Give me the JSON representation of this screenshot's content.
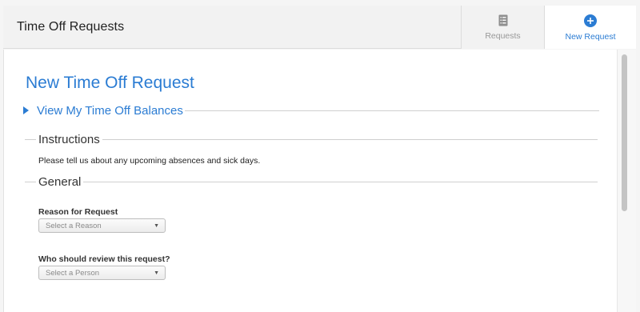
{
  "header": {
    "title": "Time Off Requests",
    "tabs": [
      {
        "label": "Requests",
        "icon": "list-document-icon"
      },
      {
        "label": "New Request",
        "icon": "plus-circle-icon",
        "active": true
      }
    ]
  },
  "main": {
    "page_title": "New Time Off Request",
    "balances_link": "View My Time Off Balances",
    "instructions": {
      "legend": "Instructions",
      "text": "Please tell us about any upcoming absences and sick days."
    },
    "general": {
      "legend": "General",
      "reason": {
        "label": "Reason for Request",
        "placeholder": "Select a Reason"
      },
      "reviewer": {
        "label": "Who should review this request?",
        "placeholder": "Select a Person"
      }
    }
  },
  "colors": {
    "accent": "#2b7cd3",
    "header_bg": "#f2f2f2"
  }
}
